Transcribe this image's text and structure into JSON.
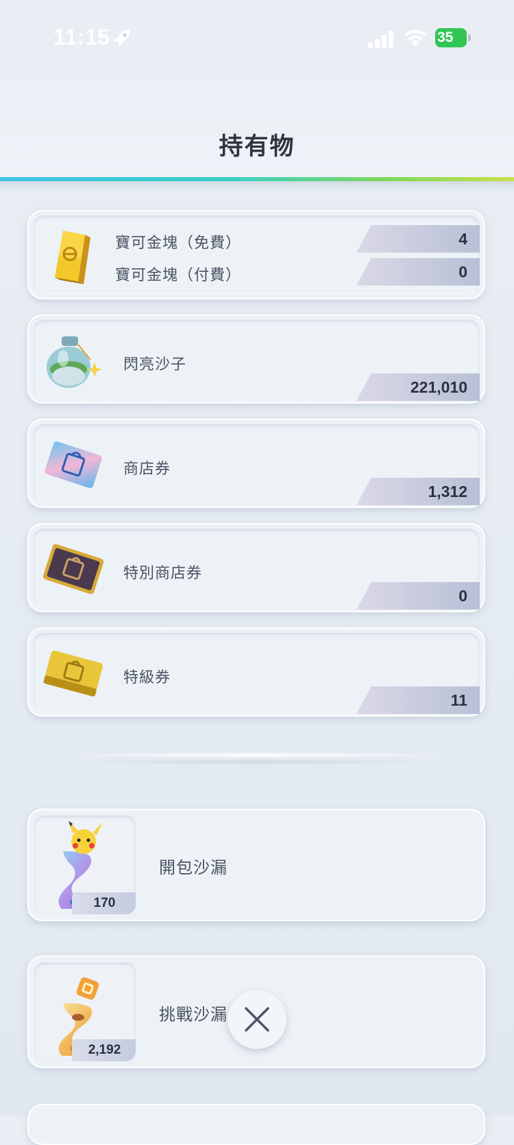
{
  "status_bar": {
    "time": "11:15",
    "battery": "35"
  },
  "header": {
    "title": "持有物"
  },
  "items": [
    {
      "icon": "gold-bar-icon",
      "rows": [
        {
          "label": "寶可金塊（免費）",
          "count": "4"
        },
        {
          "label": "寶可金塊（付費）",
          "count": "0"
        }
      ]
    },
    {
      "icon": "shiny-sand-icon",
      "label": "閃亮沙子",
      "count": "221,010"
    },
    {
      "icon": "shop-ticket-icon",
      "label": "商店券",
      "count": "1,312"
    },
    {
      "icon": "special-shop-ticket-icon",
      "label": "特別商店券",
      "count": "0"
    },
    {
      "icon": "premium-ticket-icon",
      "label": "特級券",
      "count": "11"
    }
  ],
  "hourglasses": [
    {
      "icon": "pack-hourglass-icon",
      "label": "開包沙漏",
      "count": "170"
    },
    {
      "icon": "challenge-hourglass-icon",
      "label": "挑戰沙漏",
      "count": "2,192"
    }
  ],
  "colors": {
    "rainbow_start": "#3fc3e6",
    "rainbow_end": "#c9e04a",
    "battery": "#31c553"
  }
}
